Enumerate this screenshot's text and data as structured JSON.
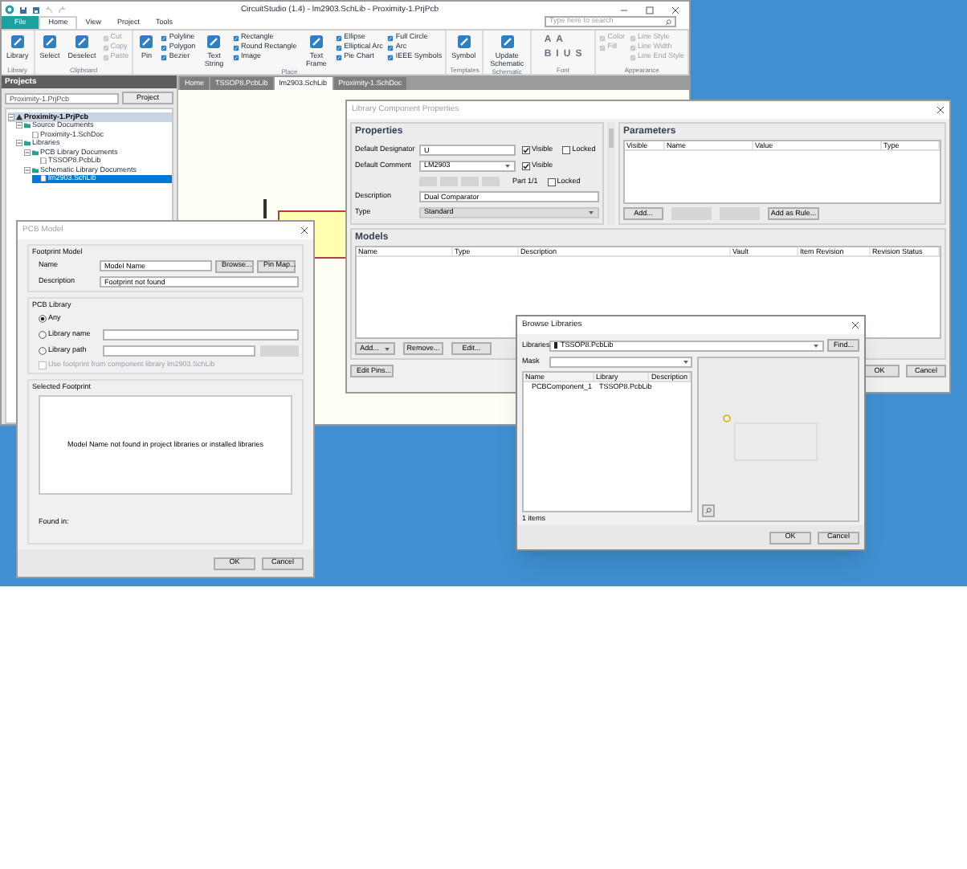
{
  "main_window": {
    "title": "CircuitStudio (1.4) - lm2903.SchLib - Proximity-1.PrjPcb",
    "ribbon_tabs": [
      {
        "label": "File",
        "kind": "file",
        "selected": false
      },
      {
        "label": "Home",
        "kind": "tab",
        "selected": true
      },
      {
        "label": "View",
        "kind": "tab",
        "selected": false
      },
      {
        "label": "Project",
        "kind": "tab",
        "selected": false
      },
      {
        "label": "Tools",
        "kind": "tab",
        "selected": false
      }
    ],
    "search": {
      "placeholder": "Type here to search"
    },
    "ribbon_groups": [
      {
        "label": "Library",
        "items": [
          {
            "kind": "large",
            "label": "Library",
            "disabled": false
          }
        ]
      },
      {
        "label": "Clipboard",
        "items": [
          {
            "kind": "large",
            "label": "Select",
            "disabled": false
          },
          {
            "kind": "large",
            "label": "Deselect",
            "disabled": false
          },
          {
            "kind": "stack",
            "items": [
              {
                "label": "Cut",
                "disabled": true
              },
              {
                "label": "Copy",
                "disabled": true
              },
              {
                "label": "Paste",
                "disabled": true
              }
            ]
          }
        ]
      },
      {
        "label": "Place",
        "items": [
          {
            "kind": "large",
            "label": "Pin",
            "disabled": false
          },
          {
            "kind": "stack",
            "items": [
              {
                "label": "Polyline",
                "disabled": false
              },
              {
                "label": "Polygon",
                "disabled": false
              },
              {
                "label": "Bezier",
                "disabled": false
              }
            ]
          },
          {
            "kind": "large",
            "label": "Text String",
            "disabled": false
          },
          {
            "kind": "stack",
            "items": [
              {
                "label": "Rectangle",
                "disabled": false
              },
              {
                "label": "Round Rectangle",
                "disabled": false
              },
              {
                "label": "Image",
                "disabled": false
              }
            ]
          },
          {
            "kind": "large",
            "label": "Text Frame",
            "disabled": false
          },
          {
            "kind": "stack",
            "items": [
              {
                "label": "Ellipse",
                "disabled": false
              },
              {
                "label": "Elliptical Arc",
                "disabled": false
              },
              {
                "label": "Pie Chart",
                "disabled": false
              }
            ]
          },
          {
            "kind": "stack",
            "items": [
              {
                "label": "Full Circle",
                "disabled": false
              },
              {
                "label": "Arc",
                "disabled": false
              },
              {
                "label": "IEEE Symbols",
                "disabled": false
              }
            ]
          }
        ]
      },
      {
        "label": "Templates",
        "items": [
          {
            "kind": "large",
            "label": "Symbol",
            "disabled": false
          }
        ]
      },
      {
        "label": "Schematic",
        "items": [
          {
            "kind": "large",
            "label": "Update Schematic",
            "disabled": false
          }
        ]
      },
      {
        "label": "Font",
        "items": [
          {
            "kind": "glyphs",
            "rows": [
              [
                "A",
                "A"
              ],
              [
                "B",
                "I",
                "U",
                "S"
              ]
            ],
            "disabled": true
          }
        ]
      },
      {
        "label": "Appearance",
        "items": [
          {
            "kind": "stack",
            "items": [
              {
                "label": "Color",
                "disabled": true
              },
              {
                "label": "Fill",
                "disabled": true
              }
            ]
          },
          {
            "kind": "stack",
            "items": [
              {
                "label": "Line Style",
                "disabled": true
              },
              {
                "label": "Line Width",
                "disabled": true
              },
              {
                "label": "Line End Style",
                "disabled": true
              }
            ]
          }
        ]
      }
    ]
  },
  "projects_panel": {
    "title": "Projects",
    "project_field": "Proximity-1.PrjPcb",
    "project_button": "Project",
    "tree": [
      {
        "label": "Proximity-1.PrjPcb",
        "kind": "project",
        "selected": false,
        "children": [
          {
            "label": "Source Documents",
            "kind": "folder",
            "selected": false,
            "children": [
              {
                "label": "Proximity-1.SchDoc",
                "kind": "file",
                "selected": false
              }
            ]
          },
          {
            "label": "Libraries",
            "kind": "folder",
            "selected": false,
            "children": [
              {
                "label": "PCB Library Documents",
                "kind": "folder",
                "selected": false,
                "children": [
                  {
                    "label": "TSSOP8.PcbLib",
                    "kind": "file",
                    "selected": false
                  }
                ]
              },
              {
                "label": "Schematic Library Documents",
                "kind": "folder",
                "selected": false,
                "children": [
                  {
                    "label": "lm2903.SchLib",
                    "kind": "file",
                    "selected": true
                  }
                ]
              }
            ]
          }
        ]
      }
    ]
  },
  "doc_tabs": [
    {
      "label": "Home",
      "selected": false
    },
    {
      "label": "TSSOP8.PcbLib",
      "selected": false
    },
    {
      "label": "lm2903.SchLib",
      "selected": true
    },
    {
      "label": "Proximity-1.SchDoc",
      "selected": false
    }
  ],
  "component_dialog": {
    "title": "Library Component Properties",
    "properties": {
      "title": "Properties",
      "designator": {
        "label": "Default Designator",
        "value": "U",
        "checks": [
          {
            "label": "Visible",
            "checked": true
          },
          {
            "label": "Locked",
            "checked": false
          }
        ]
      },
      "comment": {
        "label": "Default Comment",
        "value": "LM2903",
        "checks": [
          {
            "label": "Visible",
            "checked": true
          }
        ]
      },
      "part": {
        "label": "Part 1/1",
        "checks": [
          {
            "label": "Locked",
            "checked": false
          }
        ]
      },
      "description": {
        "label": "Description",
        "value": "Dual Comparator"
      },
      "type": {
        "label": "Type",
        "value": "Standard"
      }
    },
    "parameters": {
      "title": "Parameters",
      "columns": [
        "Visible",
        "Name",
        "Value",
        "Type"
      ],
      "buttons": [
        {
          "label": "Add...",
          "disabled": false
        },
        {
          "disabled": true
        },
        {
          "disabled": true
        },
        {
          "label": "Add as Rule...",
          "disabled": false
        }
      ]
    },
    "models": {
      "title": "Models",
      "columns": [
        "Name",
        "Type",
        "Description",
        "Vault",
        "Item Revision",
        "Revision Status"
      ],
      "buttons": [
        {
          "label": "Add...",
          "dropdown": true
        },
        {
          "label": "Remove...",
          "dropdown": false
        },
        {
          "label": "Edit...",
          "dropdown": false
        }
      ]
    },
    "edit_pins_button": "Edit Pins...",
    "buttons": [
      "OK",
      "Cancel"
    ]
  },
  "pcb_model_dialog": {
    "title": "PCB Model",
    "footprint_model": {
      "title": "Footprint Model",
      "name_label": "Name",
      "name_value": "Model Name",
      "browse_button": "Browse...",
      "pin_map_button": "Pin Map...",
      "description_label": "Description",
      "description_value": "Footprint not found"
    },
    "pcb_library": {
      "title": "PCB Library",
      "options": [
        {
          "label": "Any",
          "selected": true
        },
        {
          "label": "Library name",
          "selected": false
        },
        {
          "label": "Library path",
          "selected": false
        }
      ],
      "use_footprint": {
        "label": "Use footprint from component library lm2903.SchLib",
        "checked": false
      }
    },
    "selected_footprint": {
      "title": "Selected Footprint",
      "message": "Model Name not found in project libraries or installed libraries",
      "found_in": "Found in:"
    },
    "buttons": [
      "OK",
      "Cancel"
    ]
  },
  "browse_dialog": {
    "title": "Browse Libraries",
    "libraries_label": "Libraries",
    "libraries_value": "TSSOP8.PcbLib",
    "find_button": "Find...",
    "mask_label": "Mask",
    "columns": [
      "Name",
      "Library",
      "Description"
    ],
    "rows": [
      {
        "cells": [
          "PCBComponent_1",
          "TSSOP8.PcbLib"
        ]
      }
    ],
    "count": "1 items",
    "buttons": [
      "OK",
      "Cancel"
    ]
  }
}
